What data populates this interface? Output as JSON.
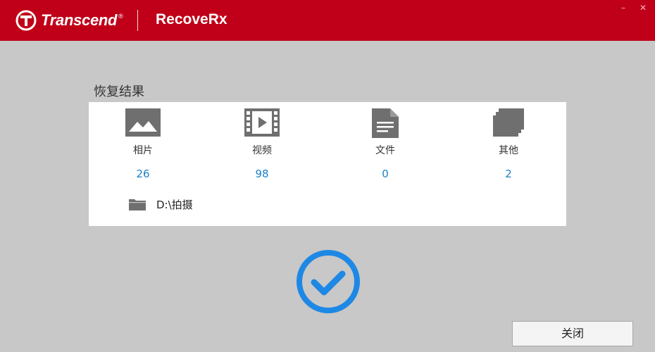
{
  "header": {
    "brand": "Transcend",
    "brand_mark": "®",
    "app_name": "RecoveRx",
    "minimize_glyph": "–",
    "close_glyph": "✕"
  },
  "results": {
    "title": "恢复结果",
    "categories": [
      {
        "label": "相片",
        "count": "26",
        "icon": "photo-icon"
      },
      {
        "label": "视频",
        "count": "98",
        "icon": "video-icon"
      },
      {
        "label": "文件",
        "count": "0",
        "icon": "document-icon"
      },
      {
        "label": "其他",
        "count": "2",
        "icon": "other-files-icon"
      }
    ],
    "output_path": "D:\\拍摄"
  },
  "footer": {
    "close_label": "关闭"
  },
  "colors": {
    "header_bg": "#c00018",
    "page_bg": "#c8c8c8",
    "count_blue": "#1a7fc6",
    "check_blue": "#1e88e5",
    "icon_gray": "#6f6f6f"
  }
}
